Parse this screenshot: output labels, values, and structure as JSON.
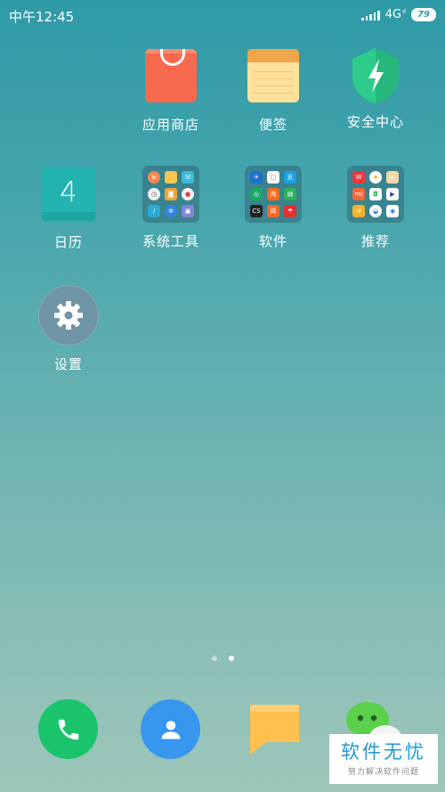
{
  "status_bar": {
    "time": "中午12:45",
    "network": "4G",
    "network_sub": "..ıl",
    "battery": "79"
  },
  "apps": {
    "app_store": "应用商店",
    "notes": "便签",
    "security": "安全中心",
    "calendar": "日历",
    "calendar_day": "4",
    "system_tools": "系统工具",
    "software": "软件",
    "recommend": "推荐",
    "settings": "设置"
  },
  "watermark": {
    "title": "软件无忧",
    "subtitle": "努力解决软件问题"
  },
  "colors": {
    "phone": "#1ac46a",
    "contacts": "#3796ee",
    "messages": "#ffc04e",
    "wechat": "#5bd04a",
    "store": "#f76a4d",
    "notes": "#fee19a",
    "security": "#2ecc8a",
    "calendar": "#23b3b0",
    "settings": "#6f94a6"
  }
}
